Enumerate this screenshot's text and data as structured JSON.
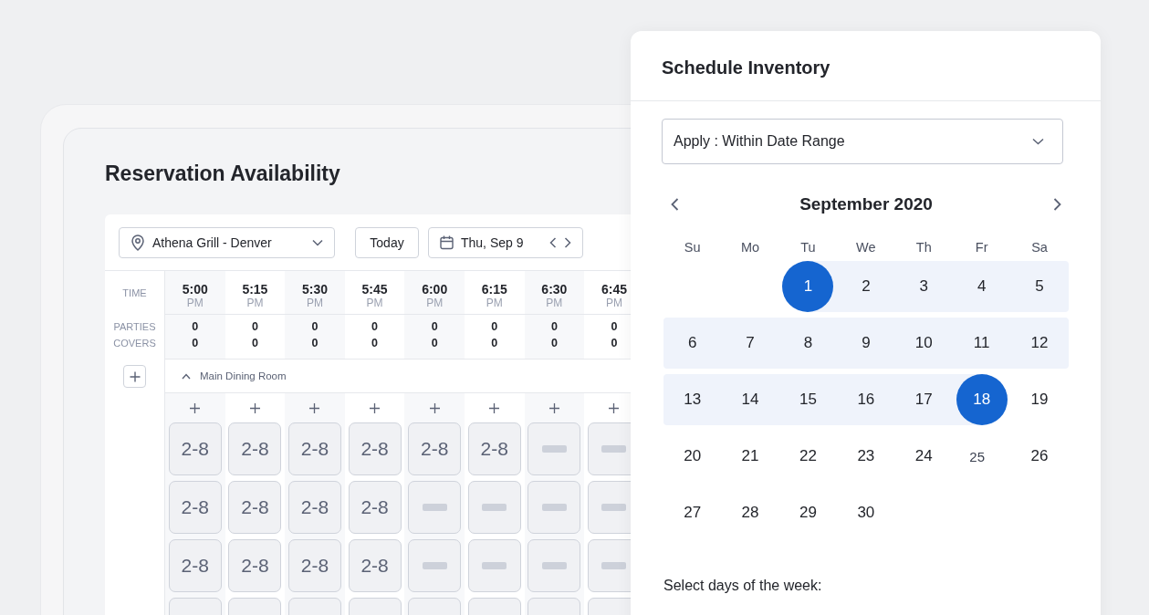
{
  "heading": "Reservation Availability",
  "toolbar": {
    "location": "Athena Grill - Denver",
    "today_button": "Today",
    "date": "Thu, Sep 9"
  },
  "grid": {
    "row_labels": {
      "time": "TIME",
      "parties": "PARTIES",
      "covers": "COVERS"
    },
    "section": {
      "name": "Main Dining Room",
      "expanded": true
    },
    "columns": [
      {
        "time": "5:00",
        "period": "PM",
        "parties": "0",
        "covers": "0",
        "slots": [
          {
            "kind": "range",
            "label": "2-8"
          },
          {
            "kind": "range",
            "label": "2-8"
          },
          {
            "kind": "range",
            "label": "2-8"
          },
          {
            "kind": "partial"
          }
        ]
      },
      {
        "time": "5:15",
        "period": "PM",
        "parties": "0",
        "covers": "0",
        "slots": [
          {
            "kind": "range",
            "label": "2-8"
          },
          {
            "kind": "range",
            "label": "2-8"
          },
          {
            "kind": "range",
            "label": "2-8"
          },
          {
            "kind": "partial"
          }
        ]
      },
      {
        "time": "5:30",
        "period": "PM",
        "parties": "0",
        "covers": "0",
        "slots": [
          {
            "kind": "range",
            "label": "2-8"
          },
          {
            "kind": "range",
            "label": "2-8"
          },
          {
            "kind": "range",
            "label": "2-8"
          },
          {
            "kind": "partial"
          }
        ]
      },
      {
        "time": "5:45",
        "period": "PM",
        "parties": "0",
        "covers": "0",
        "slots": [
          {
            "kind": "range",
            "label": "2-8"
          },
          {
            "kind": "range",
            "label": "2-8"
          },
          {
            "kind": "range",
            "label": "2-8"
          },
          {
            "kind": "partial"
          }
        ]
      },
      {
        "time": "6:00",
        "period": "PM",
        "parties": "0",
        "covers": "0",
        "slots": [
          {
            "kind": "range",
            "label": "2-8"
          },
          {
            "kind": "empty"
          },
          {
            "kind": "empty"
          },
          {
            "kind": "partial"
          }
        ]
      },
      {
        "time": "6:15",
        "period": "PM",
        "parties": "0",
        "covers": "0",
        "slots": [
          {
            "kind": "range",
            "label": "2-8"
          },
          {
            "kind": "empty"
          },
          {
            "kind": "empty"
          },
          {
            "kind": "partial"
          }
        ]
      },
      {
        "time": "6:30",
        "period": "PM",
        "parties": "0",
        "covers": "0",
        "slots": [
          {
            "kind": "empty"
          },
          {
            "kind": "empty"
          },
          {
            "kind": "empty"
          },
          {
            "kind": "partial"
          }
        ]
      },
      {
        "time": "6:45",
        "period": "PM",
        "parties": "0",
        "covers": "0",
        "slots": [
          {
            "kind": "empty"
          },
          {
            "kind": "empty"
          },
          {
            "kind": "empty"
          },
          {
            "kind": "partial"
          }
        ]
      }
    ]
  },
  "panel": {
    "title": "Schedule Inventory",
    "apply_select": "Apply : Within Date Range",
    "calendar": {
      "month": "September 2020",
      "weekdays": [
        "Su",
        "Mo",
        "Tu",
        "We",
        "Th",
        "Fr",
        "Sa"
      ],
      "weeks": [
        {
          "kind": "right_aligned",
          "days": [
            {
              "label": "1",
              "selected": true,
              "in_range": true,
              "today": false
            },
            {
              "label": "2",
              "selected": false,
              "in_range": true,
              "today": false
            },
            {
              "label": "3",
              "selected": false,
              "in_range": true,
              "today": false
            },
            {
              "label": "4",
              "selected": false,
              "in_range": true,
              "today": false
            },
            {
              "label": "5",
              "selected": false,
              "in_range": true,
              "today": false
            }
          ]
        },
        {
          "kind": "left_aligned",
          "days": [
            {
              "label": "6",
              "selected": false,
              "in_range": true,
              "today": false
            },
            {
              "label": "7",
              "selected": false,
              "in_range": true,
              "today": false
            },
            {
              "label": "8",
              "selected": false,
              "in_range": true,
              "today": false
            },
            {
              "label": "9",
              "selected": false,
              "in_range": true,
              "today": false
            },
            {
              "label": "10",
              "selected": false,
              "in_range": true,
              "today": false
            },
            {
              "label": "11",
              "selected": false,
              "in_range": true,
              "today": false
            },
            {
              "label": "12",
              "selected": false,
              "in_range": true,
              "today": false
            }
          ]
        },
        {
          "kind": "left_aligned",
          "days": [
            {
              "label": "13",
              "selected": false,
              "in_range": true,
              "today": false
            },
            {
              "label": "14",
              "selected": false,
              "in_range": true,
              "today": false
            },
            {
              "label": "15",
              "selected": false,
              "in_range": true,
              "today": false
            },
            {
              "label": "16",
              "selected": false,
              "in_range": true,
              "today": false
            },
            {
              "label": "17",
              "selected": false,
              "in_range": true,
              "today": false
            },
            {
              "label": "18",
              "selected": true,
              "in_range": true,
              "today": false
            },
            {
              "label": "19",
              "selected": false,
              "in_range": false,
              "today": false
            }
          ]
        },
        {
          "kind": "left_aligned",
          "days": [
            {
              "label": "20",
              "selected": false,
              "in_range": false,
              "today": false
            },
            {
              "label": "21",
              "selected": false,
              "in_range": false,
              "today": false
            },
            {
              "label": "22",
              "selected": false,
              "in_range": false,
              "today": false
            },
            {
              "label": "23",
              "selected": false,
              "in_range": false,
              "today": false
            },
            {
              "label": "24",
              "selected": false,
              "in_range": false,
              "today": false
            },
            {
              "label": "25",
              "selected": false,
              "in_range": false,
              "today": true
            },
            {
              "label": "26",
              "selected": false,
              "in_range": false,
              "today": false
            }
          ]
        },
        {
          "kind": "left_aligned",
          "days": [
            {
              "label": "27",
              "selected": false,
              "in_range": false,
              "today": false
            },
            {
              "label": "28",
              "selected": false,
              "in_range": false,
              "today": false
            },
            {
              "label": "29",
              "selected": false,
              "in_range": false,
              "today": false
            },
            {
              "label": "30",
              "selected": false,
              "in_range": false,
              "today": false
            }
          ]
        }
      ]
    },
    "weekdays_prompt": "Select days of the week:"
  }
}
